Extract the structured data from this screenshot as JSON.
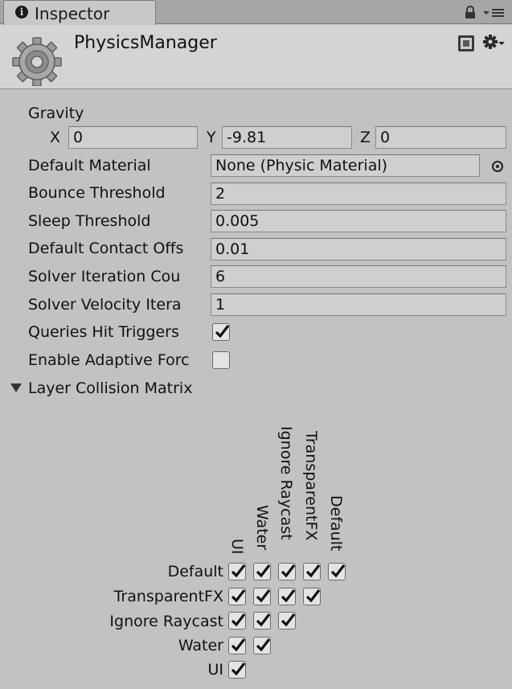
{
  "tab": {
    "label": "Inspector",
    "info_icon": "info-icon",
    "lock_icon": "lock-icon",
    "menu_icon": "context-menu-icon"
  },
  "header": {
    "title": "PhysicsManager",
    "component_icon": "gear-icon",
    "help_icon": "book-icon",
    "settings_icon": "settings-gear-icon"
  },
  "gravity": {
    "label": "Gravity",
    "x_label": "X",
    "x": "0",
    "y_label": "Y",
    "y": "-9.81",
    "z_label": "Z",
    "z": "0"
  },
  "properties": {
    "default_material": {
      "label": "Default Material",
      "value": "None (Physic Material)"
    },
    "bounce_threshold": {
      "label": "Bounce Threshold",
      "value": "2"
    },
    "sleep_threshold": {
      "label": "Sleep Threshold",
      "value": "0.005"
    },
    "default_contact_offset": {
      "label": "Default Contact Offs",
      "value": "0.01"
    },
    "solver_iteration_count": {
      "label": "Solver Iteration Cou",
      "value": "6"
    },
    "solver_velocity_iterations": {
      "label": "Solver Velocity Itera",
      "value": "1"
    },
    "queries_hit_triggers": {
      "label": "Queries Hit Triggers",
      "checked": true
    },
    "enable_adaptive_force": {
      "label": "Enable Adaptive Forc",
      "checked": false
    }
  },
  "collision_matrix": {
    "label": "Layer Collision Matrix",
    "columns": [
      "UI",
      "Water",
      "Ignore Raycast",
      "TransparentFX",
      "Default"
    ],
    "rows": [
      "Default",
      "TransparentFX",
      "Ignore Raycast",
      "Water",
      "UI"
    ],
    "checked": [
      [
        true,
        true,
        true,
        true,
        true
      ],
      [
        true,
        true,
        true,
        true
      ],
      [
        true,
        true,
        true
      ],
      [
        true,
        true
      ],
      [
        true
      ]
    ]
  },
  "colors": {
    "panel_bg": "#c2c2c2",
    "header_bg": "#d4d4d4",
    "field_bg": "#cfcfcf",
    "tab_bar_bg": "#a6a6a6"
  }
}
